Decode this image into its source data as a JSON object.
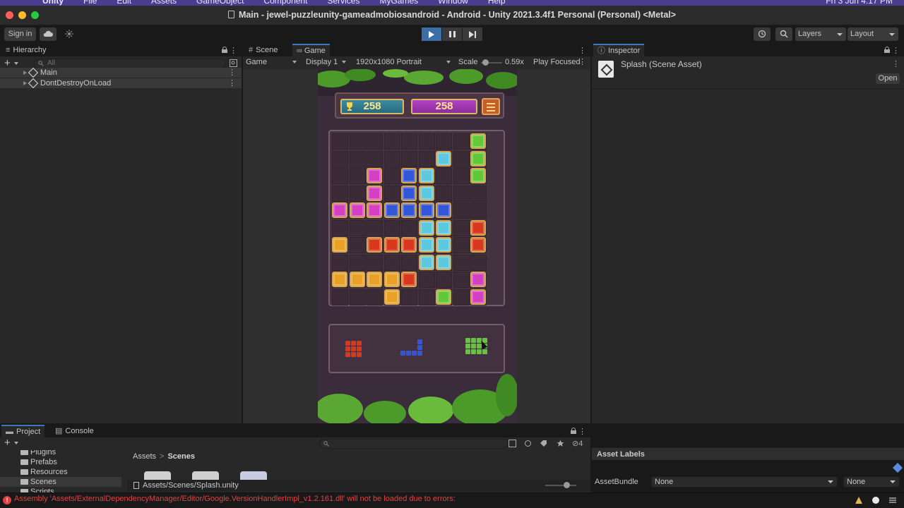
{
  "menubar": {
    "app": "Unity",
    "items": [
      "File",
      "Edit",
      "Assets",
      "GameObject",
      "Component",
      "Services",
      "MyGames",
      "Window",
      "Help"
    ],
    "clock": "Fri 3 Jun  4:17 PM"
  },
  "window": {
    "title": "Main - jewel-puzzleunity-gameadmobiosandroid - Android - Unity 2021.3.4f1 Personal (Personal) <Metal>"
  },
  "toolbar": {
    "sign_in": "Sign in",
    "layers": "Layers",
    "layout": "Layout"
  },
  "hierarchy": {
    "tab": "Hierarchy",
    "search_placeholder": "All",
    "items": [
      {
        "label": "Main",
        "selected": true
      },
      {
        "label": "DontDestroyOnLoad",
        "selected": true
      }
    ]
  },
  "gameview": {
    "tabs": [
      "Scene",
      "Game"
    ],
    "active_tab": "Game",
    "mode": "Game",
    "display": "Display 1",
    "resolution": "1920x1080 Portrait",
    "scale_label": "Scale",
    "scale_value": "0.59x",
    "play_focused": "Play Focused"
  },
  "game": {
    "best_score": "258",
    "current_score": "258",
    "colors": {
      "pink": "#d43fc4",
      "blue": "#3355d8",
      "cyan": "#5ec8de",
      "green": "#62c83a",
      "red": "#d8381e",
      "orange": "#e8a026"
    },
    "board": [
      "........G",
      "......C.G",
      "..P.BC..G",
      "..P.BC...",
      "PPPBBBB..",
      ".....CC.R",
      "O.RRRCC.R",
      ".....CC..",
      "OOOOR...P",
      "...O..G.P"
    ]
  },
  "inspector": {
    "tab": "Inspector",
    "title": "Splash (Scene Asset)",
    "open_button": "Open",
    "asset_labels": "Asset Labels",
    "asset_bundle_label": "AssetBundle",
    "asset_bundle_value": "None",
    "asset_bundle_variant": "None"
  },
  "project": {
    "tabs": [
      "Project",
      "Console"
    ],
    "tree": [
      {
        "label": "Plugins"
      },
      {
        "label": "Prefabs"
      },
      {
        "label": "Resources"
      },
      {
        "label": "Scenes",
        "selected": true
      },
      {
        "label": "Scripts"
      }
    ],
    "breadcrumb": [
      "Assets",
      "Scenes"
    ],
    "path": "Assets/Scenes/Splash.unity",
    "hidden_count": "4"
  },
  "status": {
    "error": "Assembly 'Assets/ExternalDependencyManager/Editor/Google.VersionHandlerImpl_v1.2.161.dll' will not be loaded due to errors:"
  }
}
